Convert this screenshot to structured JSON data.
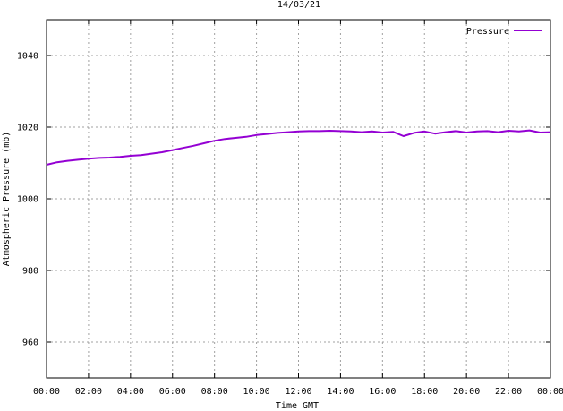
{
  "chart_data": {
    "type": "line",
    "title": "14/03/21",
    "xlabel": "Time GMT",
    "ylabel": "Atmospheric Pressure (mb)",
    "xlim": [
      0,
      24
    ],
    "ylim": [
      950,
      1050
    ],
    "x_ticks": [
      0,
      2,
      4,
      6,
      8,
      10,
      12,
      14,
      16,
      18,
      20,
      22,
      24
    ],
    "x_tick_labels": [
      "00:00",
      "02:00",
      "04:00",
      "06:00",
      "08:00",
      "10:00",
      "12:00",
      "14:00",
      "16:00",
      "18:00",
      "20:00",
      "22:00",
      "00:00"
    ],
    "y_ticks": [
      960,
      980,
      1000,
      1020,
      1040
    ],
    "y_tick_labels": [
      "960",
      "980",
      "1000",
      "1020",
      "1040"
    ],
    "grid": true,
    "legend_position": "top-right",
    "series": [
      {
        "name": "Pressure",
        "color": "#9400d3",
        "x": [
          0,
          0.5,
          1,
          1.5,
          2,
          2.5,
          3,
          3.5,
          4,
          4.5,
          5,
          5.5,
          6,
          6.5,
          7,
          7.5,
          8,
          8.5,
          9,
          9.5,
          10,
          10.5,
          11,
          11.5,
          12,
          12.5,
          13,
          13.5,
          14,
          14.5,
          15,
          15.5,
          16,
          16.5,
          17,
          17.5,
          18,
          18.5,
          19,
          19.5,
          20,
          20.5,
          21,
          21.5,
          22,
          22.5,
          23,
          23.5,
          24
        ],
        "values": [
          1009.5,
          1010.2,
          1010.6,
          1010.9,
          1011.2,
          1011.4,
          1011.5,
          1011.7,
          1012.0,
          1012.2,
          1012.6,
          1013.0,
          1013.6,
          1014.2,
          1014.8,
          1015.5,
          1016.2,
          1016.7,
          1017.0,
          1017.3,
          1017.8,
          1018.1,
          1018.4,
          1018.6,
          1018.8,
          1018.9,
          1018.9,
          1019.0,
          1018.9,
          1018.8,
          1018.6,
          1018.8,
          1018.5,
          1018.7,
          1017.5,
          1018.4,
          1018.8,
          1018.2,
          1018.6,
          1018.9,
          1018.5,
          1018.8,
          1018.9,
          1018.6,
          1019.0,
          1018.8,
          1019.1,
          1018.5,
          1018.6
        ]
      }
    ]
  }
}
